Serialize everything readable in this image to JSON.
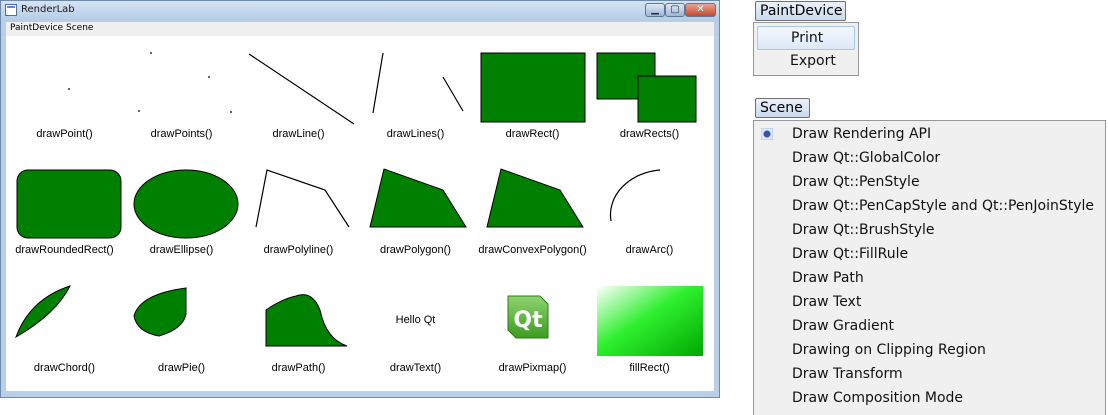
{
  "window": {
    "title": "RenderLab",
    "menu": [
      "PaintDevice",
      "Scene"
    ],
    "buttons": {
      "minimize": "▁",
      "maximize": "▢",
      "close": "✕"
    }
  },
  "colors": {
    "shape_fill": "#008000",
    "shape_stroke": "#000000",
    "qt_logo": "#41b028"
  },
  "tiles": [
    "drawPoint()",
    "drawPoints()",
    "drawLine()",
    "drawLines()",
    "drawRect()",
    "drawRects()",
    "drawRoundedRect()",
    "drawEllipse()",
    "drawPolyline()",
    "drawPolygon()",
    "drawConvexPolygon()",
    "drawArc()",
    "drawChord()",
    "drawPie()",
    "drawPath()",
    "drawText()",
    "drawPixmap()",
    "fillRect()"
  ],
  "hello_text": "Hello Qt",
  "qt_logo_text": "Qt",
  "paintdevice_menu": {
    "title": "PaintDevice",
    "items": [
      "Print",
      "Export"
    ],
    "hovered_index": 0
  },
  "scene_menu": {
    "title": "Scene",
    "checked_index": 0,
    "items": [
      "Draw Rendering API",
      "Draw Qt::GlobalColor",
      "Draw Qt::PenStyle",
      "Draw Qt::PenCapStyle and Qt::PenJoinStyle",
      "Draw Qt::BrushStyle",
      "Draw Qt::FillRule",
      "Draw Path",
      "Draw Text",
      "Draw Gradient",
      "Drawing on Clipping Region",
      "Draw Transform",
      "Draw Composition Mode"
    ]
  }
}
